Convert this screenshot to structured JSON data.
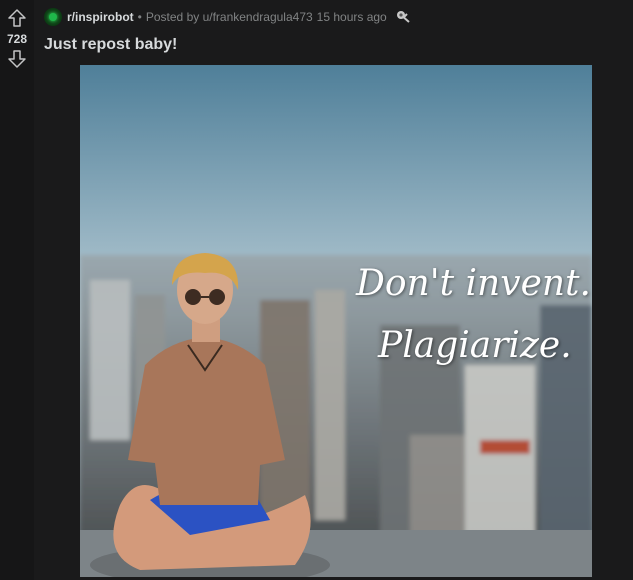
{
  "vote": {
    "count": "728"
  },
  "post": {
    "subreddit": "r/inspirobot",
    "posted_by": "Posted by u/frankendragula473",
    "time": "15 hours ago",
    "title": "Just repost baby!"
  },
  "image": {
    "line1": "Don't invent.",
    "line2": "Plagiarize."
  },
  "icons": {
    "upvote": "arrow-up-icon",
    "downvote": "arrow-down-icon",
    "subreddit": "subreddit-icon",
    "award": "award-icon"
  },
  "colors": {
    "background": "#1a1a1b",
    "text": "#d7dadc",
    "meta": "#818384",
    "subreddit_icon": "#1fb84a"
  }
}
